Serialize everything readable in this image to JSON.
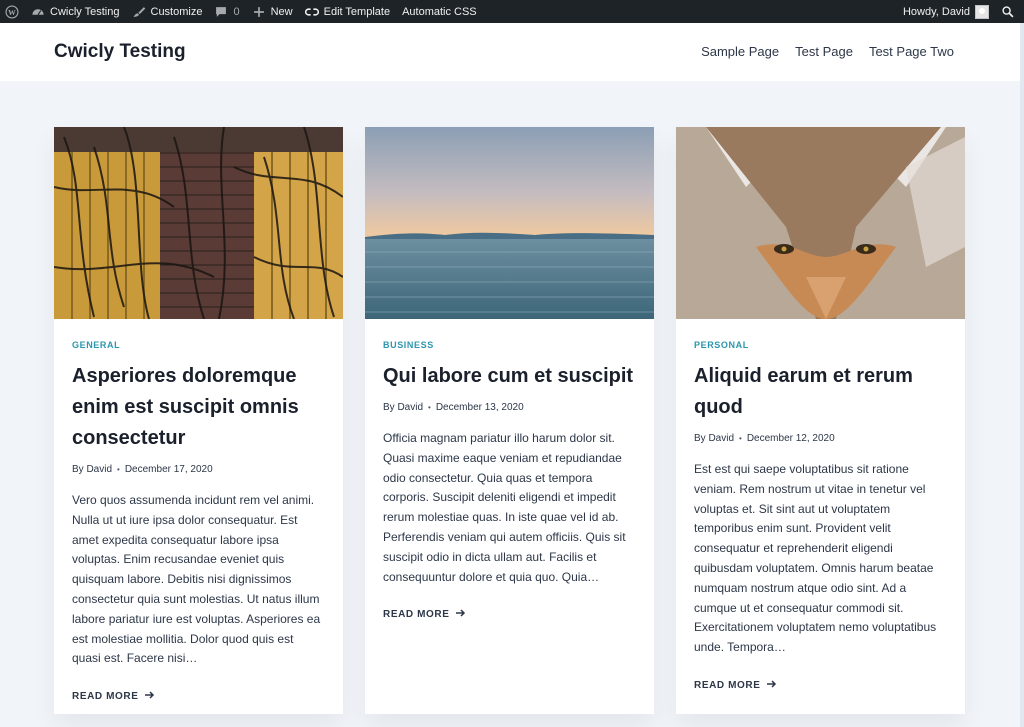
{
  "admin_bar": {
    "site_name": "Cwicly Testing",
    "customize": "Customize",
    "comments_count": "0",
    "new": "New",
    "edit_template": "Edit Template",
    "automatic_css": "Automatic CSS",
    "howdy": "Howdy, David"
  },
  "header": {
    "title": "Cwicly Testing",
    "nav": [
      "Sample Page",
      "Test Page",
      "Test Page Two"
    ]
  },
  "posts": [
    {
      "category": "GENERAL",
      "title": "Asperiores doloremque enim est suscipit omnis consectetur",
      "author": "By David",
      "date": "December 17, 2020",
      "excerpt": "Vero quos assumenda incidunt rem vel animi. Nulla ut ut iure ipsa dolor consequatur. Est amet expedita consequatur labore ipsa voluptas. Enim recusandae eveniet quis quisquam labore. Debitis nisi dignissimos consectetur quia sunt molestias. Ut natus illum labore pariatur iure est voluptas. Asperiores ea est molestiae mollitia. Dolor quod quis est quasi est. Facere nisi…",
      "read_more": "READ MORE"
    },
    {
      "category": "BUSINESS",
      "title": "Qui labore cum et suscipit",
      "author": "By David",
      "date": "December 13, 2020",
      "excerpt": "Officia magnam pariatur illo harum dolor sit. Quasi maxime eaque veniam et repudiandae odio consectetur. Quia quas et tempora corporis. Suscipit deleniti eligendi et impedit rerum molestiae quas. In iste quae vel id ab. Perferendis veniam qui autem officiis. Quis sit suscipit odio in dicta ullam aut. Facilis et consequuntur dolore et quia quo. Quia…",
      "read_more": "READ MORE"
    },
    {
      "category": "PERSONAL",
      "title": "Aliquid earum et rerum quod",
      "author": "By David",
      "date": "December 12, 2020",
      "excerpt": "Est est qui saepe voluptatibus sit ratione veniam. Rem nostrum ut vitae in tenetur vel voluptas et. Sit sint aut ut voluptatem temporibus enim sunt. Provident velit consequatur et reprehenderit eligendi quibusdam voluptatem. Omnis harum beatae numquam nostrum atque odio sint. Ad a cumque ut et consequatur commodi sit. Exercitationem voluptatem nemo voluptatibus unde. Tempora…",
      "read_more": "READ MORE"
    }
  ],
  "icons": {
    "wordpress": "wordpress-logo-icon",
    "dashboard": "dashboard-icon",
    "customize": "paintbrush-icon",
    "comments": "speech-bubble-icon",
    "new": "plus-icon",
    "edit": "link-icon",
    "search": "search-icon",
    "arrow": "arrow-right-icon"
  },
  "colors": {
    "admin_bar": "#1d2327",
    "category": "#2b96ad",
    "page_background": "#f1f5f9",
    "heading": "#1a202c"
  }
}
